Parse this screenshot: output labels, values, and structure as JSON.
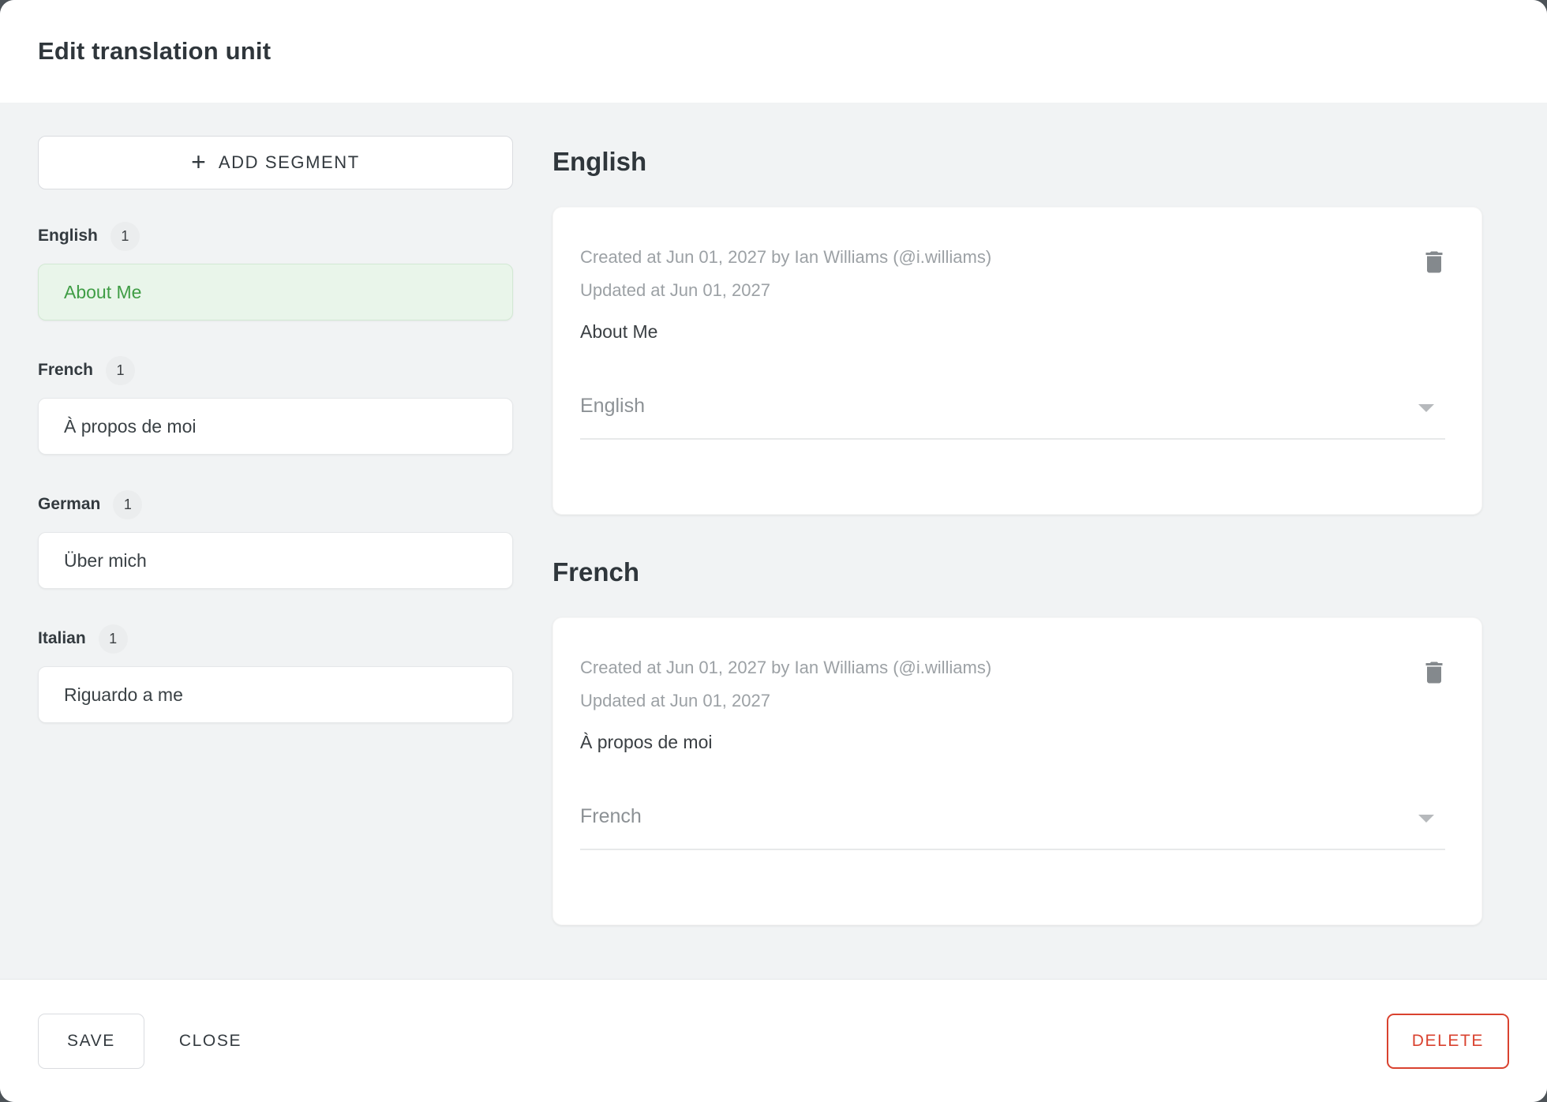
{
  "dialog": {
    "title": "Edit translation unit"
  },
  "sidebar": {
    "add_segment": {
      "label": "ADD SEGMENT",
      "plus_icon": "+"
    },
    "groups": [
      {
        "language": "English",
        "count": "1",
        "segment": "About Me",
        "selected": true
      },
      {
        "language": "French",
        "count": "1",
        "segment": "À propos de moi",
        "selected": false
      },
      {
        "language": "German",
        "count": "1",
        "segment": "Über mich",
        "selected": false
      },
      {
        "language": "Italian",
        "count": "1",
        "segment": "Riguardo a me",
        "selected": false
      }
    ]
  },
  "main": {
    "sections": [
      {
        "heading": "English",
        "created_line": "Created at Jun 01, 2027 by Ian Williams (@i.williams)",
        "updated_line": "Updated at Jun 01, 2027",
        "content": "About Me",
        "language_select": "English"
      },
      {
        "heading": "French",
        "created_line": "Created at Jun 01, 2027 by Ian Williams (@i.williams)",
        "updated_line": "Updated at Jun 01, 2027",
        "content": "À propos de moi",
        "language_select": "French"
      }
    ]
  },
  "footer": {
    "save_label": "SAVE",
    "close_label": "CLOSE",
    "delete_label": "DELETE"
  },
  "icons": {
    "add_segment": "plus-icon",
    "delete_segment": "trash-icon",
    "select_expand": "chevron-down-icon"
  },
  "colors": {
    "accent_green": "#3f9d45",
    "selected_bg": "#e9f5ea",
    "selected_border": "#d2e8d3",
    "delete_red": "#d9422f",
    "body_bg": "#f1f3f4",
    "meta_gray": "#9ca1a5"
  }
}
